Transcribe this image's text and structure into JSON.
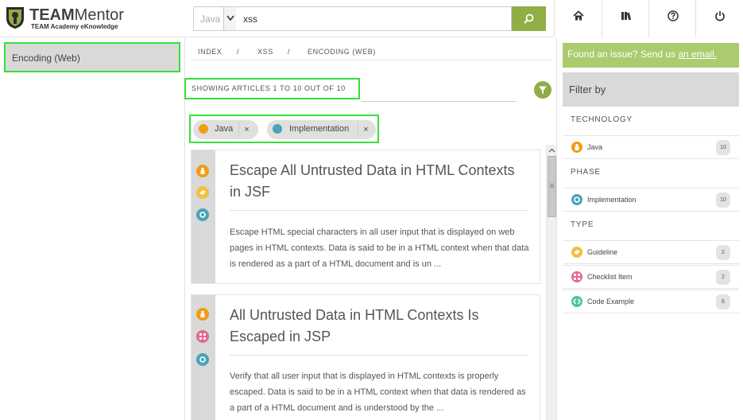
{
  "brand": {
    "title_bold": "TEAM",
    "title_rest": "Mentor",
    "subtitle": "TEAM Academy eKnowledge"
  },
  "search": {
    "language": "Java",
    "query": "xss"
  },
  "nav": [
    "home-icon",
    "library-icon",
    "help-icon",
    "power-icon"
  ],
  "left_panel": {
    "selected_item": "Encoding (Web)"
  },
  "breadcrumb": {
    "items": [
      "INDEX",
      "XSS",
      "ENCODING (WEB)"
    ],
    "separator": "/"
  },
  "results": {
    "summary": "SHOWING ARTICLES 1 TO 10 OUT OF 10"
  },
  "active_filters": [
    {
      "label": "Java",
      "icon": "java-icon",
      "color": "#f39c12",
      "remove": "×"
    },
    {
      "label": "Implementation",
      "icon": "gear-icon",
      "color": "#4aa3b8",
      "remove": "×"
    }
  ],
  "articles": [
    {
      "title": "Escape All Untrusted Data in HTML Contexts in JSF",
      "body": "Escape HTML special characters in all user input that is displayed on web pages in HTML contexts. Data is said to be in a HTML context when that data is rendered as a part of a HTML document and is un ...",
      "icons": [
        "java-icon",
        "guideline-icon",
        "gear-icon"
      ]
    },
    {
      "title": "All Untrusted Data in HTML Contexts Is Escaped in JSP",
      "body": "Verify that all user input that is displayed in HTML contexts is properly escaped. Data is said to be in a HTML context when that data is rendered as a part of a HTML document and is understood by the ...",
      "icons": [
        "java-icon",
        "checklist-icon",
        "gear-icon"
      ]
    }
  ],
  "issue_banner": {
    "text": "Found an issue? Send us ",
    "link": "an email."
  },
  "filter_panel": {
    "heading": "Filter by",
    "facets": [
      {
        "title": "TECHNOLOGY",
        "items": [
          {
            "label": "Java",
            "count": "10",
            "icon": "java-icon",
            "color": "#f39c12"
          }
        ]
      },
      {
        "title": "PHASE",
        "items": [
          {
            "label": "Implementation",
            "count": "10",
            "icon": "gear-icon",
            "color": "#4aa3b8"
          }
        ]
      },
      {
        "title": "TYPE",
        "items": [
          {
            "label": "Guideline",
            "count": "2",
            "icon": "guideline-icon",
            "color": "#f0c040"
          },
          {
            "label": "Checklist Item",
            "count": "2",
            "icon": "checklist-icon",
            "color": "#e36b8a"
          },
          {
            "label": "Code Example",
            "count": "6",
            "icon": "code-icon",
            "color": "#4cc3a8"
          }
        ]
      }
    ]
  },
  "colors": {
    "accent": "#8fae45",
    "highlight": "#35e03a",
    "issue_bg": "#aacc6f",
    "panel_gray": "#d9d9d9"
  }
}
